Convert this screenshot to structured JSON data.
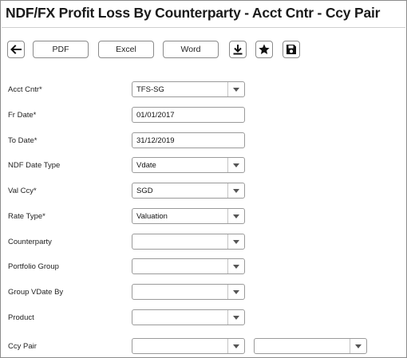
{
  "page": {
    "title": "NDF/FX Profit Loss By Counterparty - Acct Cntr - Ccy Pair"
  },
  "toolbar": {
    "back_icon": "left-arrow-icon",
    "pdf_label": "PDF",
    "excel_label": "Excel",
    "word_label": "Word",
    "download_icon": "download-icon",
    "favorite_icon": "star-icon",
    "save_icon": "floppy-disk-icon"
  },
  "form": {
    "acct_cntr": {
      "label": "Acct Cntr*",
      "value": "TFS-SG"
    },
    "fr_date": {
      "label": "Fr Date*",
      "value": "01/01/2017"
    },
    "to_date": {
      "label": "To Date*",
      "value": "31/12/2019"
    },
    "ndf_date_type": {
      "label": "NDF Date Type",
      "value": "Vdate"
    },
    "val_ccy": {
      "label": "Val Ccy*",
      "value": "SGD"
    },
    "rate_type": {
      "label": "Rate Type*",
      "value": "Valuation"
    },
    "counterparty": {
      "label": "Counterparty",
      "value": ""
    },
    "portfolio_group": {
      "label": "Portfolio Group",
      "value": ""
    },
    "group_vdate_by": {
      "label": "Group VDate By",
      "value": ""
    },
    "product": {
      "label": "Product",
      "value": ""
    },
    "ccy_pair": {
      "label": "Ccy Pair",
      "value_1": "",
      "value_2": ""
    }
  }
}
